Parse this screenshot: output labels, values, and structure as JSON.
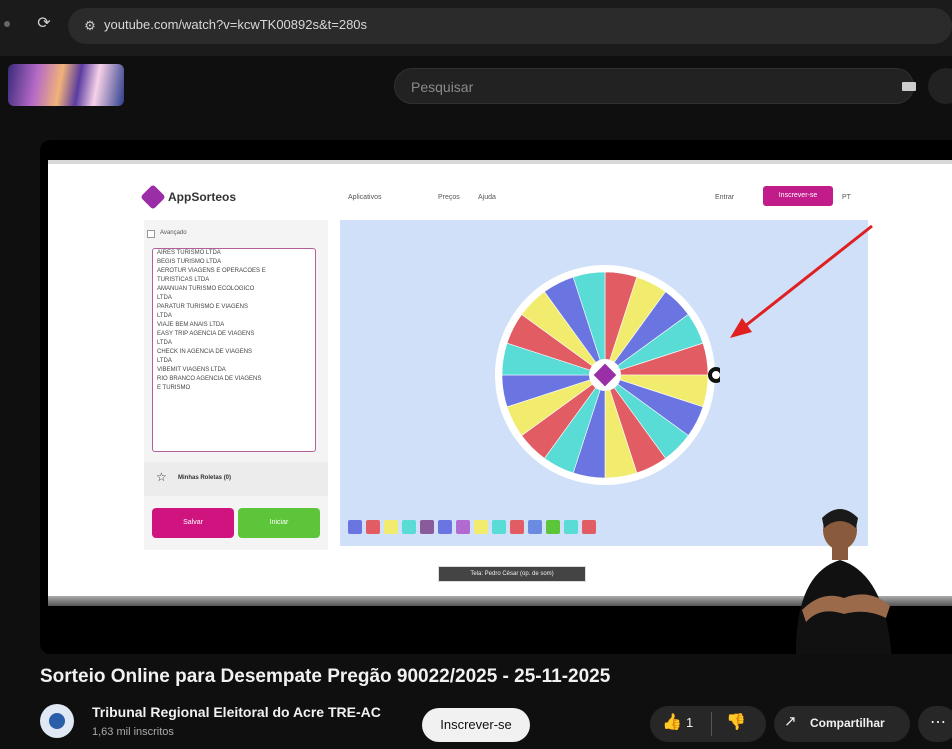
{
  "browser": {
    "url": "youtube.com/watch?v=kcwTK00892s&t=280s",
    "reload_icon": "⟳",
    "site_info_icon": "⚙"
  },
  "youtube_header": {
    "search_placeholder": "Pesquisar"
  },
  "video_frame": {
    "app_name": "AppSorteos",
    "nav": {
      "apps": "Aplicativos",
      "prices": "Preços",
      "help": "Ajuda",
      "login": "Entrar",
      "signup": "Inscrever-se",
      "lang": "PT"
    },
    "advanced_label": "Avançado",
    "entries": [
      "AIRES TURISMO LTDA",
      "BEGIS TURISMO LTDA",
      "AEROTUR VIAGENS E OPERACOES E",
      "TURISTICAS LTDA",
      "AMANUAN TURISMO ECOLOGICO",
      "LTDA",
      "PARATUR TURISMO E VIAGENS",
      "LTDA",
      "VIAJE BEM ANAIS LTDA",
      "EASY TRIP AGENCIA DE VIAGENS",
      "LTDA",
      "CHECK IN AGENCIA DE VIAGENS",
      "LTDA",
      "VIBEMIT VIAGENS LTDA",
      "RIO BRANCO AGENCIA DE VIAGENS",
      "E TURISMO"
    ],
    "my_wheels_label": "Minhas Roletas",
    "my_wheels_count": "(0)",
    "save_label": "Salvar",
    "start_label": "Iniciar",
    "credit": "Tela: Pedro César (op. de som)",
    "wheel_colors": [
      "#e25d63",
      "#f1ec6e",
      "#6b75e2",
      "#59dcd6",
      "#e25d63",
      "#f1ec6e",
      "#6b75e2",
      "#59dcd6",
      "#e25d63",
      "#f1ec6e",
      "#6b75e2",
      "#59dcd6",
      "#e25d63",
      "#f1ec6e",
      "#6b75e2",
      "#59dcd6",
      "#e25d63",
      "#f1ec6e",
      "#6b75e2",
      "#59dcd6"
    ]
  },
  "video": {
    "title": "Sorteio Online para Desempate Pregão 90022/2025 - 25-11-2025",
    "channel": "Tribunal Regional Eleitoral do Acre TRE-AC",
    "subscribers": "1,63 mil inscritos",
    "subscribe_label": "Inscrever-se",
    "like_icon": "👍",
    "like_count": "1",
    "dislike_icon": "👎",
    "share_icon": "↗",
    "share_label": "Compartilhar",
    "more_icon": "⋯"
  }
}
